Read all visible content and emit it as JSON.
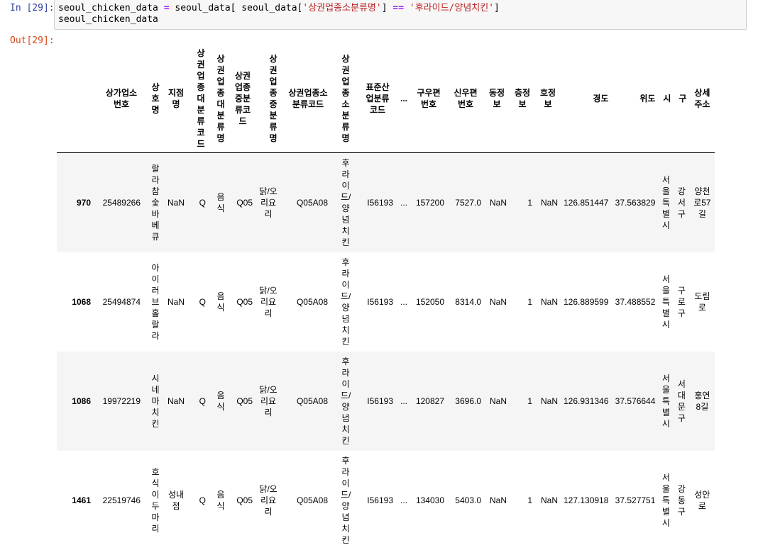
{
  "cells": {
    "in_prompt": "In [29]:",
    "out_prompt": "Out[29]:",
    "code_line1_a": "seoul_chicken_data ",
    "code_line1_eq": "=",
    "code_line1_b": " seoul_data[ seoul_data[",
    "code_line1_s1": "'상권업종소분류명'",
    "code_line1_c": "] ",
    "code_line1_op": "==",
    "code_line1_d": " ",
    "code_line1_s2": "'후라이드/양념치킨'",
    "code_line1_e": "]",
    "code_line2": "seoul_chicken_data"
  },
  "table": {
    "columns": [
      "",
      "상가업소번호",
      "상호명",
      "지점명",
      "상권업종대분류코드",
      "상권업종대분류명",
      "상권업종중분류코드",
      "상권업종중분류명",
      "상권업종소분류코드",
      "상권업종소분류명",
      "표준산업분류코드",
      "...",
      "구우편번호",
      "신우편번호",
      "동정보",
      "층정보",
      "호정보",
      "경도",
      "위도",
      "시",
      "구",
      "상세주소"
    ],
    "rows": [
      {
        "idx": "970",
        "store": "25489266",
        "name": "랄라참숯바베큐",
        "branch": "NaN",
        "lcls": "Q",
        "lclsn": "음식",
        "mcls": "Q05",
        "mclsn": "닭/오리요리",
        "scls": "Q05A08",
        "sclsn": "후라이드/양념치킨",
        "std": "I56193",
        "dots": "...",
        "oldzip": "157200",
        "newzip": "7527.0",
        "dong": "NaN",
        "floor": "1",
        "ho": "NaN",
        "lon": "126.851447",
        "lat": "37.563829",
        "si": "서울특별시",
        "gu": "강서구",
        "addr": "양천로57길"
      },
      {
        "idx": "1068",
        "store": "25494874",
        "name": "아이러브홀랄라",
        "branch": "NaN",
        "lcls": "Q",
        "lclsn": "음식",
        "mcls": "Q05",
        "mclsn": "닭/오리요리",
        "scls": "Q05A08",
        "sclsn": "후라이드/양념치킨",
        "std": "I56193",
        "dots": "...",
        "oldzip": "152050",
        "newzip": "8314.0",
        "dong": "NaN",
        "floor": "1",
        "ho": "NaN",
        "lon": "126.889599",
        "lat": "37.488552",
        "si": "서울특별시",
        "gu": "구로구",
        "addr": "도림로"
      },
      {
        "idx": "1086",
        "store": "19972219",
        "name": "시네마치킨",
        "branch": "NaN",
        "lcls": "Q",
        "lclsn": "음식",
        "mcls": "Q05",
        "mclsn": "닭/오리요리",
        "scls": "Q05A08",
        "sclsn": "후라이드/양념치킨",
        "std": "I56193",
        "dots": "...",
        "oldzip": "120827",
        "newzip": "3696.0",
        "dong": "NaN",
        "floor": "1",
        "ho": "NaN",
        "lon": "126.931346",
        "lat": "37.576644",
        "si": "서울특별시",
        "gu": "서대문구",
        "addr": "홍연8길"
      },
      {
        "idx": "1461",
        "store": "22519746",
        "name": "호식이두마리",
        "branch": "성내점",
        "lcls": "Q",
        "lclsn": "음식",
        "mcls": "Q05",
        "mclsn": "닭/오리요리",
        "scls": "Q05A08",
        "sclsn": "후라이드/양념치킨",
        "std": "I56193",
        "dots": "...",
        "oldzip": "134030",
        "newzip": "5403.0",
        "dong": "NaN",
        "floor": "1",
        "ho": "NaN",
        "lon": "127.130918",
        "lat": "37.527751",
        "si": "서울특별시",
        "gu": "강동구",
        "addr": "성안로"
      }
    ]
  }
}
